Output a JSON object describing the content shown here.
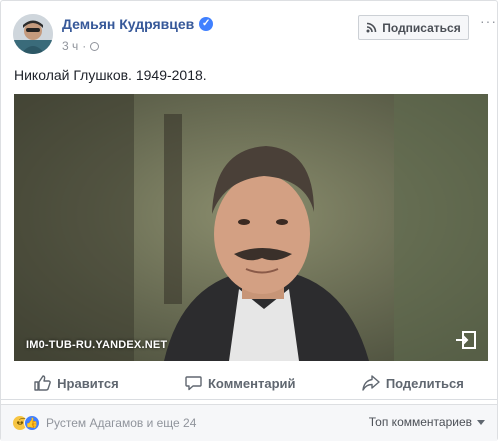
{
  "post": {
    "author_name": "Демьян Кудрявцев",
    "time": "3 ч",
    "subscribe_label": "Подписаться",
    "more_label": "···",
    "text": "Николай Глушков. 1949-2018.",
    "media": {
      "watermark": "IM0-TUB-RU.YANDEX.NET"
    }
  },
  "actions": {
    "like_label": "Нравится",
    "comment_label": "Комментарий",
    "share_label": "Поделиться"
  },
  "reactions": {
    "names": "Рустем Адагамов и еще 24",
    "sort_label": "Топ комментариев"
  },
  "colors": {
    "link_blue": "#365899",
    "verified_blue": "#4080ff",
    "action_gray": "#606770"
  }
}
